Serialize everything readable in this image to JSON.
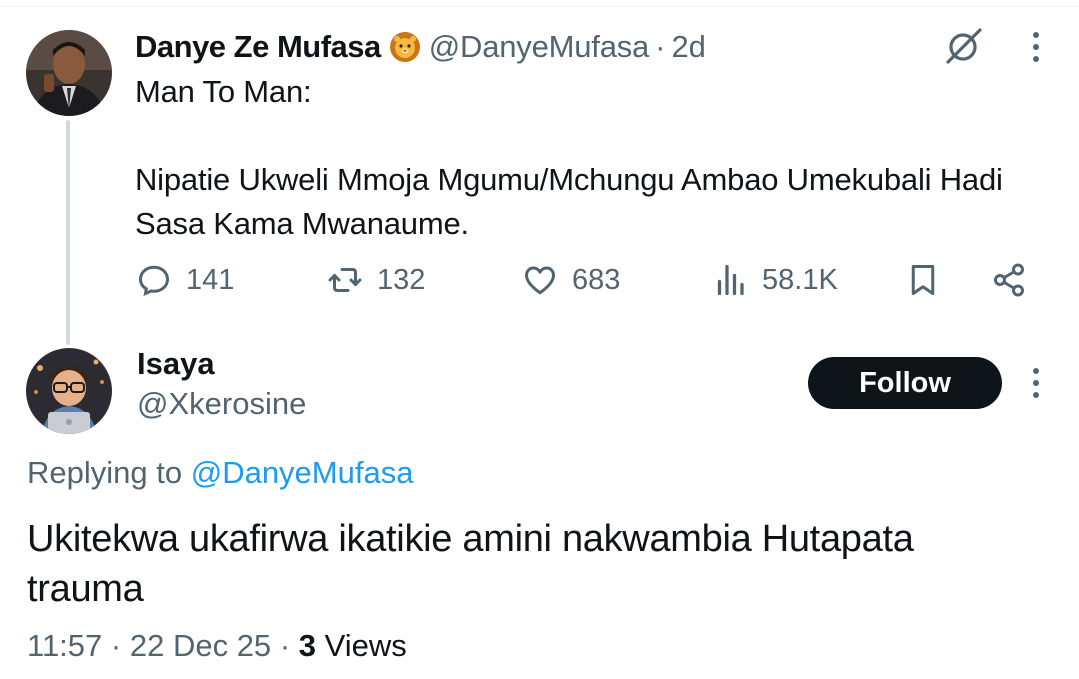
{
  "parent_tweet": {
    "display_name": "Danye Ze Mufasa",
    "emoji_icon": "lion-face-emoji",
    "handle": "@DanyeMufasa",
    "separator": "·",
    "time_ago": "2d",
    "text_line1": "Man To Man:",
    "text_line2": "Nipatie Ukweli Mmoja Mgumu/Mchungu Ambao Umekubali Hadi Sasa Kama Mwanaume.",
    "actions": {
      "replies": "141",
      "reposts": "132",
      "likes": "683",
      "views": "58.1K"
    },
    "icons": [
      "grok-icon",
      "more-options-icon",
      "reply-icon",
      "repost-icon",
      "like-icon",
      "views-icon",
      "bookmark-icon",
      "share-icon"
    ]
  },
  "reply_tweet": {
    "display_name": "Isaya",
    "handle": "@Xkerosine",
    "follow_label": "Follow",
    "replying_prefix": "Replying to ",
    "replying_handle": "@DanyeMufasa",
    "text": "Ukitekwa ukafirwa ikatikie amini nakwambia Hutapata trauma",
    "time": "11:57",
    "separator": "·",
    "date": "22 Dec 25",
    "views_count": "3",
    "views_label": "Views"
  },
  "colors": {
    "text_primary": "#0f1419",
    "text_secondary": "#536471",
    "link": "#1d9bf0",
    "follow_bg": "#0f1419",
    "thread_line": "#cfd9de"
  }
}
